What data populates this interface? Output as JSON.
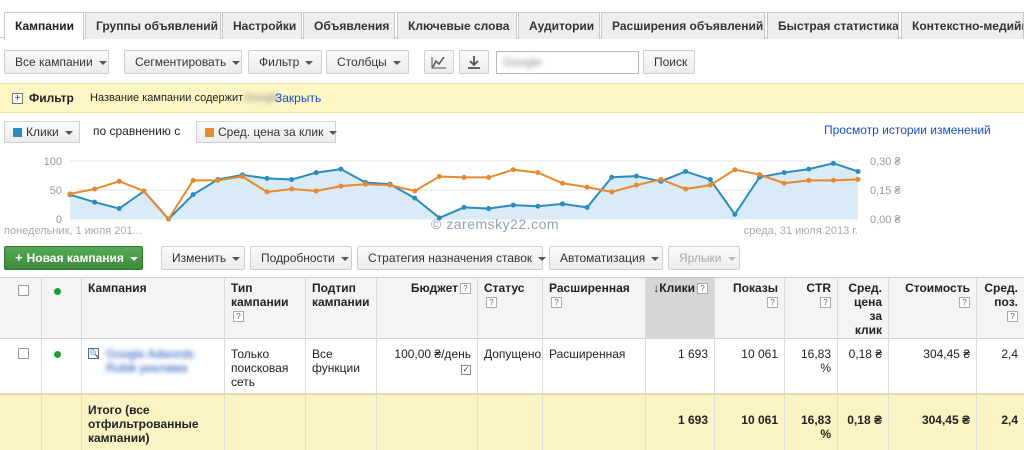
{
  "tabs": [
    {
      "label": "Кампании",
      "active": true
    },
    {
      "label": "Группы объявлений"
    },
    {
      "label": "Настройки"
    },
    {
      "label": "Объявления"
    },
    {
      "label": "Ключевые слова"
    },
    {
      "label": "Аудитории"
    },
    {
      "label": "Расширения объявлений"
    },
    {
      "label": "Быстрая статистика"
    },
    {
      "label": "Контекстно-медийная"
    }
  ],
  "toolbar": {
    "all_campaigns": "Все кампании",
    "segment": "Сегментировать",
    "filter": "Фильтр",
    "columns": "Столбцы",
    "search_value": "Google",
    "search_button": "Поиск"
  },
  "filterbar": {
    "title": "Фильтр",
    "condition": "Название кампании содержит",
    "condition_value": "Google",
    "close": "Закрыть"
  },
  "chart_controls": {
    "metric1": "Клики",
    "compare": "по сравнению с",
    "metric2": "Сред. цена за клик",
    "history_link": "Просмотр истории изменений"
  },
  "chart_data": {
    "type": "line",
    "x_start_label": "понедельник, 1 июля 201...",
    "x_end_label": "среда, 31 июля 2013 г.",
    "y_left_ticks": [
      "100",
      "50",
      "0"
    ],
    "y_right_ticks": [
      "0,30 ₴",
      "0,15 ₴",
      "0,00 ₴"
    ],
    "ylim_left": [
      0,
      100
    ],
    "ylim_right": [
      0,
      0.3
    ],
    "series": [
      {
        "name": "Клики",
        "color": "#2b8cbe",
        "axis": "left",
        "values": [
          42,
          29,
          18,
          48,
          0,
          42,
          68,
          76,
          70,
          68,
          80,
          86,
          63,
          60,
          36,
          2,
          20,
          18,
          24,
          22,
          26,
          20,
          72,
          74,
          65,
          82,
          68,
          8,
          72,
          80,
          86,
          96,
          82
        ]
      },
      {
        "name": "Сред. цена за клик",
        "color": "#e8892d",
        "axis": "right",
        "values": [
          0.13,
          0.155,
          0.195,
          0.145,
          0.0,
          0.2,
          0.2,
          0.22,
          0.14,
          0.155,
          0.145,
          0.17,
          0.18,
          0.175,
          0.145,
          0.22,
          0.215,
          0.215,
          0.255,
          0.24,
          0.185,
          0.165,
          0.14,
          0.175,
          0.205,
          0.155,
          0.175,
          0.255,
          0.23,
          0.185,
          0.2,
          0.2,
          0.205
        ]
      }
    ]
  },
  "action_bar": {
    "new_campaign": "Новая кампания",
    "edit": "Изменить",
    "details": "Подробности",
    "bid_strategy": "Стратегия назначения ставок",
    "automation": "Автоматизация",
    "labels": "Ярлыки"
  },
  "table": {
    "headers": {
      "campaign": "Кампания",
      "campaign_type": "Тип кампании",
      "subtype": "Подтип кампании",
      "budget": "Бюджет",
      "status": "Статус",
      "extended": "Расширенная",
      "clicks": "Клики",
      "impressions": "Показы",
      "ctr": "CTR",
      "avg_cpc": "Сред. цена за клик",
      "cost": "Стоимость",
      "avg_pos": "Сред. поз."
    },
    "row": {
      "campaign": "Google Adwords Rubik реклама",
      "campaign_type": "Только поисковая сеть",
      "subtype": "Все функции",
      "budget": "100,00 ₴/день",
      "status": "Допущено",
      "extended": "Расширенная",
      "clicks": "1 693",
      "impressions": "10 061",
      "ctr": "16,83 %",
      "avg_cpc": "0,18 ₴",
      "cost": "304,45 ₴",
      "avg_pos": "2,4"
    },
    "total": {
      "label": "Итого (все отфильтрованные кампании)",
      "clicks": "1 693",
      "impressions": "10 061",
      "ctr": "16,83 %",
      "avg_cpc": "0,18 ₴",
      "cost": "304,45 ₴",
      "avg_pos": "2,4"
    }
  },
  "watermark": "© zaremsky22.com"
}
